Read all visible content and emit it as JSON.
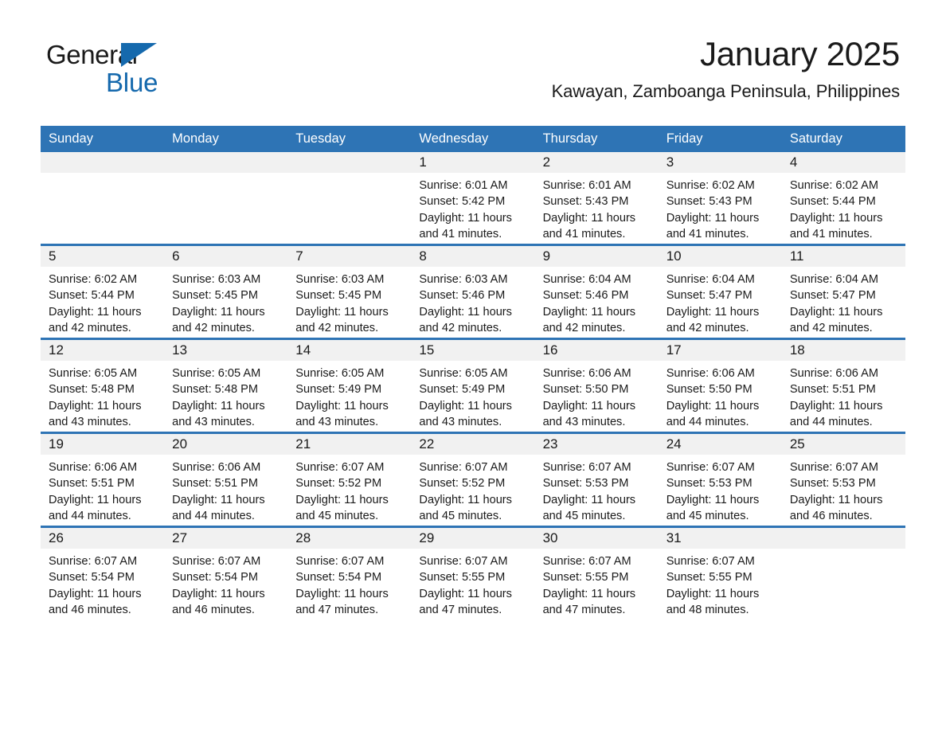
{
  "brand": {
    "name_part1": "General",
    "name_part2": "Blue",
    "triangle_color": "#1569ad"
  },
  "header": {
    "title": "January 2025",
    "subtitle": "Kawayan, Zamboanga Peninsula, Philippines"
  },
  "colors": {
    "header_blue": "#2e74b5",
    "daynum_band": "#f1f1f1",
    "text": "#1a1a1a"
  },
  "weekday_headers": [
    "Sunday",
    "Monday",
    "Tuesday",
    "Wednesday",
    "Thursday",
    "Friday",
    "Saturday"
  ],
  "weeks": [
    [
      {
        "day": "",
        "blank": true,
        "sunrise": "",
        "sunset": "",
        "daylight_line1": "",
        "daylight_line2": ""
      },
      {
        "day": "",
        "blank": true,
        "sunrise": "",
        "sunset": "",
        "daylight_line1": "",
        "daylight_line2": ""
      },
      {
        "day": "",
        "blank": true,
        "sunrise": "",
        "sunset": "",
        "daylight_line1": "",
        "daylight_line2": ""
      },
      {
        "day": "1",
        "blank": false,
        "sunrise": "Sunrise: 6:01 AM",
        "sunset": "Sunset: 5:42 PM",
        "daylight_line1": "Daylight: 11 hours",
        "daylight_line2": "and 41 minutes."
      },
      {
        "day": "2",
        "blank": false,
        "sunrise": "Sunrise: 6:01 AM",
        "sunset": "Sunset: 5:43 PM",
        "daylight_line1": "Daylight: 11 hours",
        "daylight_line2": "and 41 minutes."
      },
      {
        "day": "3",
        "blank": false,
        "sunrise": "Sunrise: 6:02 AM",
        "sunset": "Sunset: 5:43 PM",
        "daylight_line1": "Daylight: 11 hours",
        "daylight_line2": "and 41 minutes."
      },
      {
        "day": "4",
        "blank": false,
        "sunrise": "Sunrise: 6:02 AM",
        "sunset": "Sunset: 5:44 PM",
        "daylight_line1": "Daylight: 11 hours",
        "daylight_line2": "and 41 minutes."
      }
    ],
    [
      {
        "day": "5",
        "blank": false,
        "sunrise": "Sunrise: 6:02 AM",
        "sunset": "Sunset: 5:44 PM",
        "daylight_line1": "Daylight: 11 hours",
        "daylight_line2": "and 42 minutes."
      },
      {
        "day": "6",
        "blank": false,
        "sunrise": "Sunrise: 6:03 AM",
        "sunset": "Sunset: 5:45 PM",
        "daylight_line1": "Daylight: 11 hours",
        "daylight_line2": "and 42 minutes."
      },
      {
        "day": "7",
        "blank": false,
        "sunrise": "Sunrise: 6:03 AM",
        "sunset": "Sunset: 5:45 PM",
        "daylight_line1": "Daylight: 11 hours",
        "daylight_line2": "and 42 minutes."
      },
      {
        "day": "8",
        "blank": false,
        "sunrise": "Sunrise: 6:03 AM",
        "sunset": "Sunset: 5:46 PM",
        "daylight_line1": "Daylight: 11 hours",
        "daylight_line2": "and 42 minutes."
      },
      {
        "day": "9",
        "blank": false,
        "sunrise": "Sunrise: 6:04 AM",
        "sunset": "Sunset: 5:46 PM",
        "daylight_line1": "Daylight: 11 hours",
        "daylight_line2": "and 42 minutes."
      },
      {
        "day": "10",
        "blank": false,
        "sunrise": "Sunrise: 6:04 AM",
        "sunset": "Sunset: 5:47 PM",
        "daylight_line1": "Daylight: 11 hours",
        "daylight_line2": "and 42 minutes."
      },
      {
        "day": "11",
        "blank": false,
        "sunrise": "Sunrise: 6:04 AM",
        "sunset": "Sunset: 5:47 PM",
        "daylight_line1": "Daylight: 11 hours",
        "daylight_line2": "and 42 minutes."
      }
    ],
    [
      {
        "day": "12",
        "blank": false,
        "sunrise": "Sunrise: 6:05 AM",
        "sunset": "Sunset: 5:48 PM",
        "daylight_line1": "Daylight: 11 hours",
        "daylight_line2": "and 43 minutes."
      },
      {
        "day": "13",
        "blank": false,
        "sunrise": "Sunrise: 6:05 AM",
        "sunset": "Sunset: 5:48 PM",
        "daylight_line1": "Daylight: 11 hours",
        "daylight_line2": "and 43 minutes."
      },
      {
        "day": "14",
        "blank": false,
        "sunrise": "Sunrise: 6:05 AM",
        "sunset": "Sunset: 5:49 PM",
        "daylight_line1": "Daylight: 11 hours",
        "daylight_line2": "and 43 minutes."
      },
      {
        "day": "15",
        "blank": false,
        "sunrise": "Sunrise: 6:05 AM",
        "sunset": "Sunset: 5:49 PM",
        "daylight_line1": "Daylight: 11 hours",
        "daylight_line2": "and 43 minutes."
      },
      {
        "day": "16",
        "blank": false,
        "sunrise": "Sunrise: 6:06 AM",
        "sunset": "Sunset: 5:50 PM",
        "daylight_line1": "Daylight: 11 hours",
        "daylight_line2": "and 43 minutes."
      },
      {
        "day": "17",
        "blank": false,
        "sunrise": "Sunrise: 6:06 AM",
        "sunset": "Sunset: 5:50 PM",
        "daylight_line1": "Daylight: 11 hours",
        "daylight_line2": "and 44 minutes."
      },
      {
        "day": "18",
        "blank": false,
        "sunrise": "Sunrise: 6:06 AM",
        "sunset": "Sunset: 5:51 PM",
        "daylight_line1": "Daylight: 11 hours",
        "daylight_line2": "and 44 minutes."
      }
    ],
    [
      {
        "day": "19",
        "blank": false,
        "sunrise": "Sunrise: 6:06 AM",
        "sunset": "Sunset: 5:51 PM",
        "daylight_line1": "Daylight: 11 hours",
        "daylight_line2": "and 44 minutes."
      },
      {
        "day": "20",
        "blank": false,
        "sunrise": "Sunrise: 6:06 AM",
        "sunset": "Sunset: 5:51 PM",
        "daylight_line1": "Daylight: 11 hours",
        "daylight_line2": "and 44 minutes."
      },
      {
        "day": "21",
        "blank": false,
        "sunrise": "Sunrise: 6:07 AM",
        "sunset": "Sunset: 5:52 PM",
        "daylight_line1": "Daylight: 11 hours",
        "daylight_line2": "and 45 minutes."
      },
      {
        "day": "22",
        "blank": false,
        "sunrise": "Sunrise: 6:07 AM",
        "sunset": "Sunset: 5:52 PM",
        "daylight_line1": "Daylight: 11 hours",
        "daylight_line2": "and 45 minutes."
      },
      {
        "day": "23",
        "blank": false,
        "sunrise": "Sunrise: 6:07 AM",
        "sunset": "Sunset: 5:53 PM",
        "daylight_line1": "Daylight: 11 hours",
        "daylight_line2": "and 45 minutes."
      },
      {
        "day": "24",
        "blank": false,
        "sunrise": "Sunrise: 6:07 AM",
        "sunset": "Sunset: 5:53 PM",
        "daylight_line1": "Daylight: 11 hours",
        "daylight_line2": "and 45 minutes."
      },
      {
        "day": "25",
        "blank": false,
        "sunrise": "Sunrise: 6:07 AM",
        "sunset": "Sunset: 5:53 PM",
        "daylight_line1": "Daylight: 11 hours",
        "daylight_line2": "and 46 minutes."
      }
    ],
    [
      {
        "day": "26",
        "blank": false,
        "sunrise": "Sunrise: 6:07 AM",
        "sunset": "Sunset: 5:54 PM",
        "daylight_line1": "Daylight: 11 hours",
        "daylight_line2": "and 46 minutes."
      },
      {
        "day": "27",
        "blank": false,
        "sunrise": "Sunrise: 6:07 AM",
        "sunset": "Sunset: 5:54 PM",
        "daylight_line1": "Daylight: 11 hours",
        "daylight_line2": "and 46 minutes."
      },
      {
        "day": "28",
        "blank": false,
        "sunrise": "Sunrise: 6:07 AM",
        "sunset": "Sunset: 5:54 PM",
        "daylight_line1": "Daylight: 11 hours",
        "daylight_line2": "and 47 minutes."
      },
      {
        "day": "29",
        "blank": false,
        "sunrise": "Sunrise: 6:07 AM",
        "sunset": "Sunset: 5:55 PM",
        "daylight_line1": "Daylight: 11 hours",
        "daylight_line2": "and 47 minutes."
      },
      {
        "day": "30",
        "blank": false,
        "sunrise": "Sunrise: 6:07 AM",
        "sunset": "Sunset: 5:55 PM",
        "daylight_line1": "Daylight: 11 hours",
        "daylight_line2": "and 47 minutes."
      },
      {
        "day": "31",
        "blank": false,
        "sunrise": "Sunrise: 6:07 AM",
        "sunset": "Sunset: 5:55 PM",
        "daylight_line1": "Daylight: 11 hours",
        "daylight_line2": "and 48 minutes."
      },
      {
        "day": "",
        "blank": true,
        "sunrise": "",
        "sunset": "",
        "daylight_line1": "",
        "daylight_line2": ""
      }
    ]
  ]
}
